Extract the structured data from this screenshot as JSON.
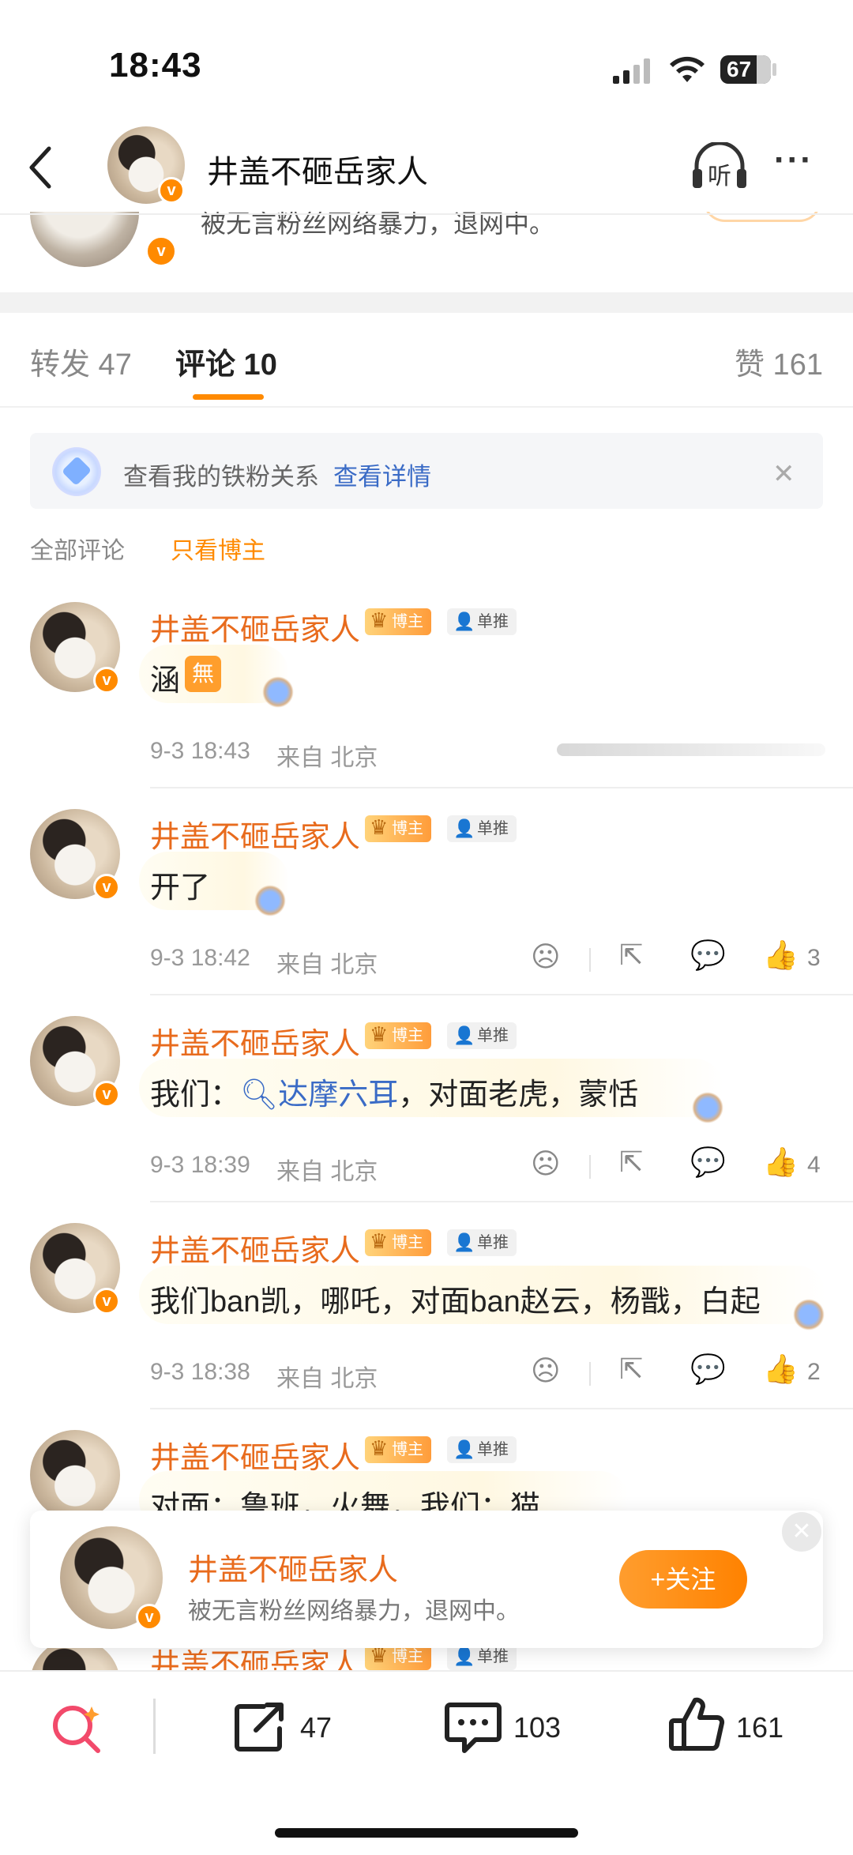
{
  "status_bar": {
    "time": "18:43",
    "battery": "67"
  },
  "header": {
    "title": "井盖不砸岳家人",
    "listen_label": "听",
    "more": "···",
    "back": "‹"
  },
  "peek": {
    "bio": "被无言粉丝网络暴力，退网中。"
  },
  "tabs": [
    {
      "label": "转发 47"
    },
    {
      "label": "评论 10"
    },
    {
      "label": "赞 161"
    }
  ],
  "fan_banner": {
    "text": "查看我的铁粉关系",
    "link": "查看详情",
    "close": "✕"
  },
  "filters": {
    "all": "全部评论",
    "author_only": "只看博主"
  },
  "badges": {
    "blogger": "博主",
    "single": "单推",
    "verified": "v"
  },
  "comments": [
    {
      "name": "井盖不砸岳家人",
      "text": "涵",
      "emoji": "無",
      "time": "9-3 18:43",
      "from": "来自 北京",
      "likes": ""
    },
    {
      "name": "井盖不砸岳家人",
      "text": "开了",
      "time": "9-3 18:42",
      "from": "来自 北京",
      "likes": "3"
    },
    {
      "name": "井盖不砸岳家人",
      "prefix": "我们：",
      "topic": "达摩六耳",
      "suffix": "，对面老虎，蒙恬",
      "time": "9-3 18:39",
      "from": "来自 北京",
      "likes": "4"
    },
    {
      "name": "井盖不砸岳家人",
      "text": "我们ban凯，哪吒，对面ban赵云，杨戬，白起",
      "time": "9-3 18:38",
      "from": "来自 北京",
      "likes": "2"
    },
    {
      "name": "井盖不砸岳家人",
      "text": "对面：鲁班，火舞，我们：猫"
    },
    {
      "name": "井盖不砸岳家人"
    }
  ],
  "follow_popup": {
    "name": "井盖不砸岳家人",
    "bio": "被无言粉丝网络暴力，退网中。",
    "button": "+关注",
    "close": "✕"
  },
  "bottom_bar": {
    "reposts": "47",
    "comments": "103",
    "likes": "161"
  },
  "colors": {
    "accent": "#ff8a00",
    "name": "#e86b1d",
    "link": "#3a6bc6"
  }
}
